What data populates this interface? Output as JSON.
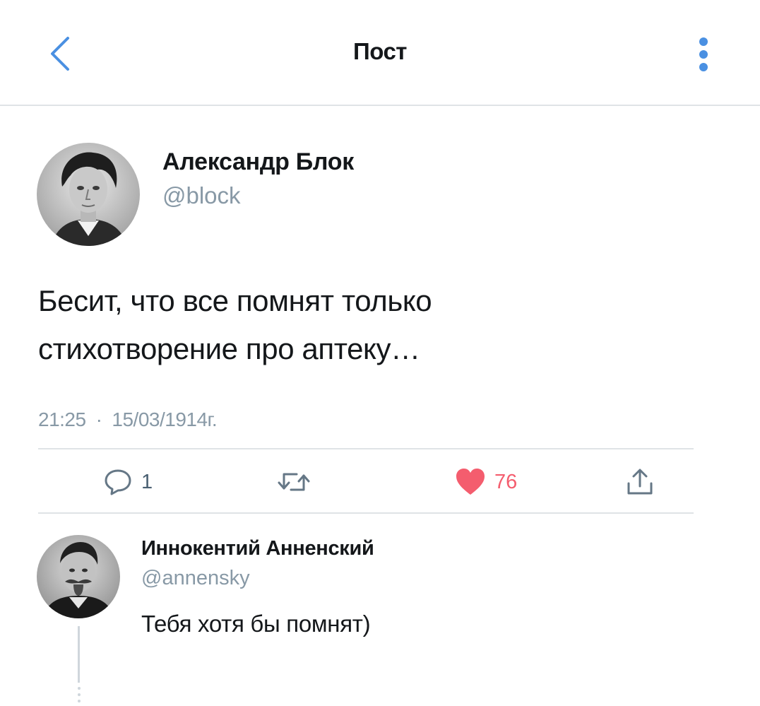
{
  "header": {
    "title": "Пост",
    "back_icon": "chevron-left-icon",
    "more_icon": "more-vertical-icon",
    "accent_color": "#4a90e2"
  },
  "post": {
    "author_name": "Александр Блок",
    "author_handle": "@block",
    "text_line1": "Бесит, что все помнят только",
    "text_line2": "стихотворение про аптеку…",
    "time": "21:25",
    "separator": "·",
    "date": "15/03/1914г.",
    "actions": {
      "reply_count": "1",
      "retweet_count": "",
      "like_count": "76",
      "like_color": "#f45d6e",
      "icons": [
        "comment-icon",
        "retweet-icon",
        "heart-icon",
        "share-icon"
      ]
    }
  },
  "reply": {
    "author_name": "Иннокентий Анненский",
    "author_handle": "@annensky",
    "text": "Тебя хотя бы помнят)"
  }
}
